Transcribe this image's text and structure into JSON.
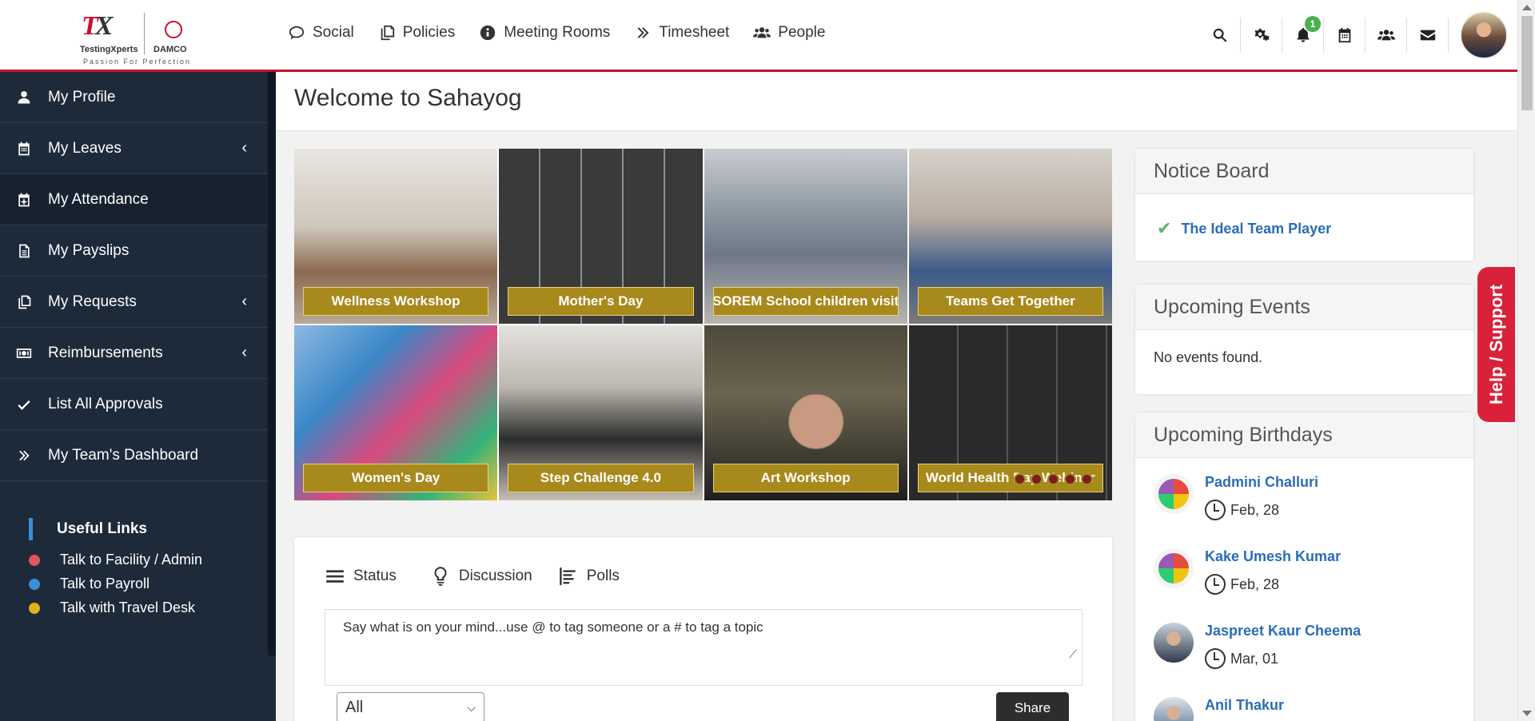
{
  "brand": {
    "logo_text": "TestingXperts",
    "partner_text": "DAMCO",
    "tagline": "Passion For Perfection"
  },
  "nav": {
    "items": [
      {
        "label": "Social",
        "icon": "chat-icon"
      },
      {
        "label": "Policies",
        "icon": "copy-icon"
      },
      {
        "label": "Meeting Rooms",
        "icon": "info-icon"
      },
      {
        "label": "Timesheet",
        "icon": "double-chevron-icon"
      },
      {
        "label": "People",
        "icon": "users-icon"
      }
    ],
    "right_icons": [
      "search-icon",
      "gears-icon",
      "bell-icon",
      "calendar-icon",
      "group-icon",
      "mail-icon"
    ],
    "notification_count": "1"
  },
  "sidebar": {
    "items": [
      {
        "label": "My Profile",
        "icon": "user-icon",
        "expandable": false
      },
      {
        "label": "My Leaves",
        "icon": "calendar-icon",
        "expandable": true
      },
      {
        "label": "My Attendance",
        "icon": "calendar-plus-icon",
        "expandable": false
      },
      {
        "label": "My Payslips",
        "icon": "document-icon",
        "expandable": false
      },
      {
        "label": "My Requests",
        "icon": "copy-icon",
        "expandable": true
      },
      {
        "label": "Reimbursements",
        "icon": "money-icon",
        "expandable": true
      },
      {
        "label": "List All Approvals",
        "icon": "check-icon",
        "expandable": false
      },
      {
        "label": "My Team's Dashboard",
        "icon": "double-chevron-icon",
        "expandable": false
      }
    ],
    "useful_links": {
      "heading": "Useful Links",
      "links": [
        {
          "label": "Talk to Facility / Admin",
          "color": "#e05563"
        },
        {
          "label": "Talk to Payroll",
          "color": "#3b8fd9"
        },
        {
          "label": "Talk with Travel Desk",
          "color": "#e0b21c"
        }
      ]
    }
  },
  "page": {
    "title": "Welcome to Sahayog"
  },
  "gallery": {
    "tiles": [
      {
        "caption": "Wellness Workshop"
      },
      {
        "caption": "Mother's Day"
      },
      {
        "caption": "SOREM School children visit"
      },
      {
        "caption": "Teams Get Together"
      },
      {
        "caption": "Women's Day"
      },
      {
        "caption": "Step Challenge 4.0"
      },
      {
        "caption": "Art Workshop"
      },
      {
        "caption": "World Health Day Webinar"
      }
    ],
    "slide_dots": 5
  },
  "composer": {
    "tabs": [
      {
        "label": "Status",
        "icon": "menu-lines-icon"
      },
      {
        "label": "Discussion",
        "icon": "lightbulb-icon"
      },
      {
        "label": "Polls",
        "icon": "poll-icon"
      }
    ],
    "placeholder": "Say what is on your mind...use @ to tag someone or a # to tag a topic",
    "audience_value": "All",
    "share_label": "Share"
  },
  "notice_board": {
    "title": "Notice Board",
    "items": [
      "The Ideal Team Player"
    ]
  },
  "upcoming_events": {
    "title": "Upcoming Events",
    "empty_text": "No events found."
  },
  "upcoming_birthdays": {
    "title": "Upcoming Birthdays",
    "people": [
      {
        "name": "Padmini Challuri",
        "date": "Feb, 28"
      },
      {
        "name": "Kake Umesh Kumar",
        "date": "Feb, 28"
      },
      {
        "name": "Jaspreet Kaur Cheema",
        "date": "Mar, 01"
      },
      {
        "name": "Anil Thakur",
        "date": ""
      }
    ]
  },
  "help_tab": "Help / Support"
}
